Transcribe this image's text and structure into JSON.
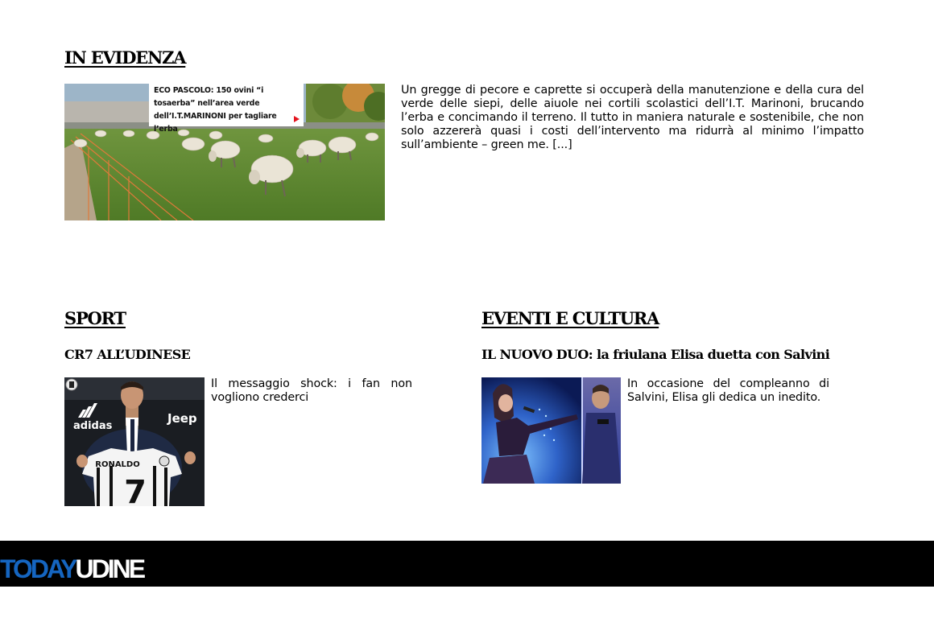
{
  "featured": {
    "heading": "IN EVIDENZA",
    "image_caption": "ECO PASCOLO: 150 ovini “i tosaerba” nell’area verde dell’I.T.MARINONI per tagliare l’erba",
    "excerpt": "Un gregge di pecore e caprette si occuperà della manutenzione e della cura del verde delle siepi, delle aiuole nei cortili scolastici dell’I.T. Marinoni, brucando l’erba e concimando il terreno. Il tutto in maniera naturale e sostenibile, che non solo azzererà quasi i costi dell’intervento ma ridurrà al minimo l’impatto sull’ambiente – green me. [...]"
  },
  "sport": {
    "heading": "SPORT",
    "title": "CR7 ALL’UDINESE",
    "excerpt": "Il messaggio shock: i fan non vogliono crederci",
    "jersey_name": "RONALDO",
    "jersey_number": "7",
    "banner_left": "adidas",
    "banner_right": "Jeep"
  },
  "culture": {
    "heading": "EVENTI E CULTURA",
    "title": "IL NUOVO DUO: la friulana Elisa duetta con Salvini",
    "excerpt": "In occasione del compleanno di Salvini, Elisa gli dedica un inedito."
  },
  "footer": {
    "logo_first": "TODAY",
    "logo_second": "UDINE"
  },
  "colors": {
    "logo_blue": "#1565c0",
    "footer_bg": "#000000",
    "caption_arrow": "#e4151f"
  },
  "icons": {
    "caption_arrow": "play-arrow-icon"
  }
}
